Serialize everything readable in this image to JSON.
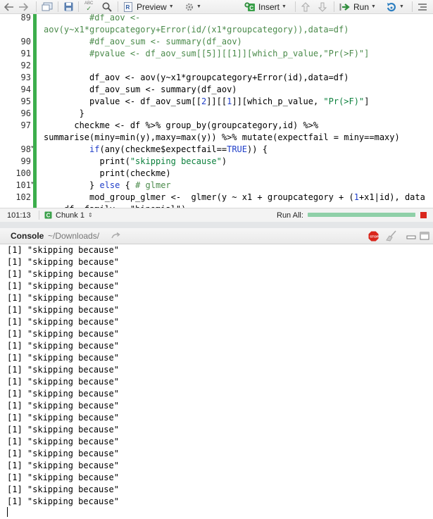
{
  "toolbar": {
    "preview_label": "Preview",
    "insert_label": "Insert",
    "run_label": "Run",
    "spell_icon_text": "ABC"
  },
  "editor": {
    "lines": [
      {
        "num": "89",
        "parts": [
          [
            "         ",
            ""
          ],
          [
            "#df_aov <-",
            "c-comment"
          ]
        ]
      },
      {
        "num": "",
        "parts": [
          [
            "aov(y~x1*groupcategory+Error(id/(x1*groupcategory)),data=df)",
            "c-comment"
          ]
        ]
      },
      {
        "num": "90",
        "parts": [
          [
            "         ",
            ""
          ],
          [
            "#df_aov_sum <- summary(df_aov)",
            "c-comment"
          ]
        ]
      },
      {
        "num": "91",
        "parts": [
          [
            "         ",
            ""
          ],
          [
            "#pvalue <- df_aov_sum[[5]][[1]][which_p_value,\"Pr(>F)\"]",
            "c-comment"
          ]
        ]
      },
      {
        "num": "92",
        "parts": [
          [
            "",
            ""
          ]
        ]
      },
      {
        "num": "93",
        "parts": [
          [
            "         df_aov <- aov(y~x1*groupcategory+Error(id),data=df)",
            ""
          ]
        ]
      },
      {
        "num": "94",
        "parts": [
          [
            "         df_aov_sum <- summary(df_aov)",
            ""
          ]
        ]
      },
      {
        "num": "95",
        "parts": [
          [
            "         pvalue <- df_aov_sum[[",
            ""
          ],
          [
            "2",
            "c-num"
          ],
          [
            "]][[",
            ""
          ],
          [
            "1",
            "c-num"
          ],
          [
            "]][which_p_value, ",
            ""
          ],
          [
            "\"Pr(>F)\"",
            "c-str"
          ],
          [
            "]",
            ""
          ]
        ]
      },
      {
        "num": "96",
        "parts": [
          [
            "       }",
            ""
          ]
        ]
      },
      {
        "num": "97",
        "parts": [
          [
            "      checkme <- df %>% group_by(groupcategory,id) %>%",
            ""
          ]
        ]
      },
      {
        "num": "",
        "parts": [
          [
            "summarise(miny=min(y),maxy=max(y)) %>% mutate(expectfail = miny==maxy)",
            ""
          ]
        ]
      },
      {
        "num": "98",
        "fold": true,
        "parts": [
          [
            "         ",
            ""
          ],
          [
            "if",
            "c-kw"
          ],
          [
            "(any(checkme$expectfail==",
            ""
          ],
          [
            "TRUE",
            "c-kw"
          ],
          [
            ")) {",
            ""
          ]
        ]
      },
      {
        "num": "99",
        "parts": [
          [
            "           print(",
            ""
          ],
          [
            "\"skipping because\"",
            "c-str"
          ],
          [
            ")",
            ""
          ]
        ]
      },
      {
        "num": "100",
        "parts": [
          [
            "           print(checkme)",
            ""
          ]
        ]
      },
      {
        "num": "101",
        "fold": true,
        "parts": [
          [
            "         } ",
            ""
          ],
          [
            "else",
            "c-kw"
          ],
          [
            " { ",
            ""
          ],
          [
            "# glmer",
            "c-comment"
          ]
        ]
      },
      {
        "num": "102",
        "parts": [
          [
            "         mod_group_glmer <-  glmer(y ~ x1 + groupcategory + (",
            ""
          ],
          [
            "1",
            "c-num"
          ],
          [
            "+x1|id), data",
            ""
          ]
        ]
      },
      {
        "num": "",
        "parts": [
          [
            "  = df, family = \"binomial\")",
            ""
          ]
        ]
      }
    ]
  },
  "status": {
    "position": "101:13",
    "chunk": "Chunk 1",
    "run_all": "Run All:"
  },
  "console": {
    "title": "Console",
    "path": "~/Downloads/",
    "output": [
      "[1] \"skipping because\"",
      "[1] \"skipping because\"",
      "[1] \"skipping because\"",
      "[1] \"skipping because\"",
      "[1] \"skipping because\"",
      "[1] \"skipping because\"",
      "[1] \"skipping because\"",
      "[1] \"skipping because\"",
      "[1] \"skipping because\"",
      "[1] \"skipping because\"",
      "[1] \"skipping because\"",
      "[1] \"skipping because\"",
      "[1] \"skipping because\"",
      "[1] \"skipping because\"",
      "[1] \"skipping because\"",
      "[1] \"skipping because\"",
      "[1] \"skipping because\"",
      "[1] \"skipping because\"",
      "[1] \"skipping because\"",
      "[1] \"skipping because\"",
      "[1] \"skipping because\"",
      "[1] \"skipping because\""
    ]
  },
  "colors": {
    "change_bar": "#3cae4c",
    "keyword": "#1f3ec9",
    "string": "#0a7f3b",
    "comment": "#4a8a4a"
  }
}
